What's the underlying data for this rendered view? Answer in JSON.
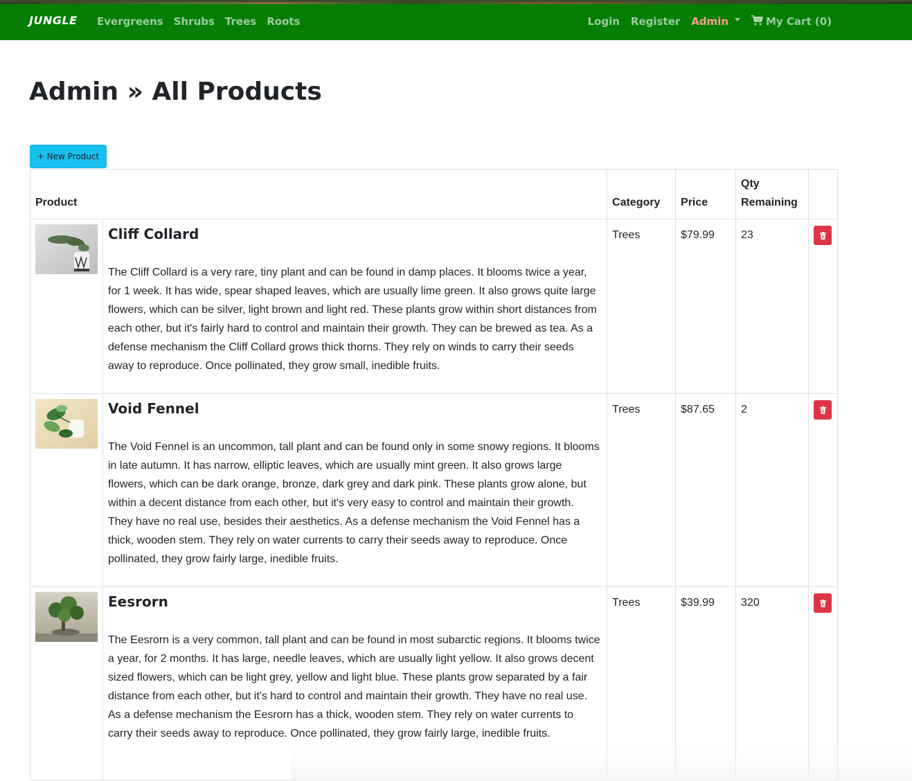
{
  "nav": {
    "brand": "JUNGLE",
    "links": [
      "Evergreens",
      "Shrubs",
      "Trees",
      "Roots"
    ],
    "login": "Login",
    "register": "Register",
    "admin": "Admin",
    "cart": "My Cart (0)"
  },
  "page": {
    "title": "Admin » All Products",
    "new_product": "+ New Product"
  },
  "table": {
    "headers": {
      "product": "Product",
      "category": "Category",
      "price": "Price",
      "qty": "Qty Remaining"
    },
    "rows": [
      {
        "name": "Cliff Collard",
        "description": "The Cliff Collard is a very rare, tiny plant and can be found in damp places. It blooms twice a year, for 1 week. It has wide, spear shaped leaves, which are usually lime green. It also grows quite large flowers, which can be silver, light brown and light red. These plants grow within short distances from each other, but it's fairly hard to control and maintain their growth. They can be brewed as tea. As a defense mechanism the Cliff Collard grows thick thorns. They rely on winds to carry their seeds away to reproduce. Once pollinated, they grow small, inedible fruits.",
        "category": "Trees",
        "price": "$79.99",
        "qty": "23"
      },
      {
        "name": "Void Fennel",
        "description": "The Void Fennel is an uncommon, tall plant and can be found only in some snowy regions. It blooms in late autumn. It has narrow, elliptic leaves, which are usually mint green. It also grows large flowers, which can be dark orange, bronze, dark grey and dark pink. These plants grow alone, but within a decent distance from each other, but it's very easy to control and maintain their growth. They have no real use, besides their aesthetics. As a defense mechanism the Void Fennel has a thick, wooden stem. They rely on water currents to carry their seeds away to reproduce. Once pollinated, they grow fairly large, inedible fruits.",
        "category": "Trees",
        "price": "$87.65",
        "qty": "2"
      },
      {
        "name": "Eesrorn",
        "description": "The Eesrorn is a very common, tall plant and can be found in most subarctic regions. It blooms twice a year, for 2 months. It has large, needle leaves, which are usually light yellow. It also grows decent sized flowers, which can be light grey, yellow and light blue. These plants grow separated by a fair distance from each other, but it's hard to control and maintain their growth. They have no real use. As a defense mechanism the Eesrorn has a thick, wooden stem. They rely on water currents to carry their seeds away to reproduce. Once pollinated, they grow fairly large, inedible fruits.",
        "category": "Trees",
        "price": "$39.99",
        "qty": "320"
      }
    ]
  },
  "colors": {
    "navbar": "#067e06",
    "admin_active": "#f4a08b",
    "new_button": "#17c0ef",
    "delete_button": "#dc3545"
  },
  "icons": {
    "cart": "shopping-cart-icon",
    "delete": "trash-icon"
  }
}
